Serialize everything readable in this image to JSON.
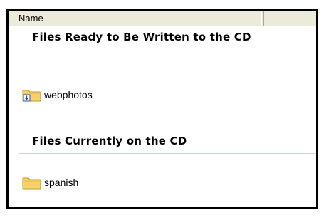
{
  "header": {
    "name_column": "Name"
  },
  "groups": [
    {
      "heading": "Files Ready to Be Written to the CD",
      "items": [
        {
          "label": "webphotos",
          "icon": "folder-pending-icon"
        }
      ]
    },
    {
      "heading": "Files Currently on the CD",
      "items": [
        {
          "label": "spanish",
          "icon": "folder-icon"
        }
      ]
    }
  ],
  "colors": {
    "folder_fill": "#f5d36a",
    "folder_edge": "#c79a2c",
    "header_bg": "#ebeadb",
    "group_line": "#c5d5e8"
  }
}
